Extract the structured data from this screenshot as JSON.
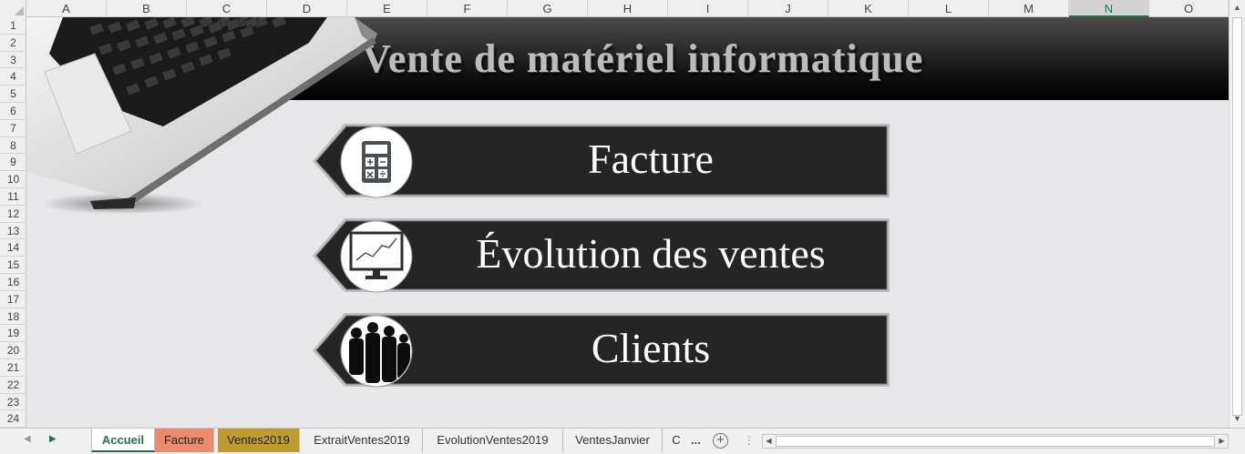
{
  "grid": {
    "columns": [
      "A",
      "B",
      "C",
      "D",
      "E",
      "F",
      "G",
      "H",
      "I",
      "J",
      "K",
      "L",
      "M",
      "N",
      "O"
    ],
    "selected_column": "N",
    "rows": [
      "1",
      "2",
      "3",
      "4",
      "5",
      "6",
      "7",
      "8",
      "9",
      "10",
      "11",
      "12",
      "13",
      "14",
      "15",
      "16",
      "17",
      "18",
      "19",
      "20",
      "21",
      "22",
      "23",
      "24"
    ]
  },
  "banner": {
    "title": "Vente de matériel informatique"
  },
  "buttons": [
    {
      "label": "Facture",
      "icon": "calculator-icon"
    },
    {
      "label": "Évolution des ventes",
      "icon": "chart-monitor-icon"
    },
    {
      "label": "Clients",
      "icon": "people-silhouette-icon"
    }
  ],
  "tabs": {
    "items": [
      {
        "label": "Accueil",
        "style": "active"
      },
      {
        "label": "Facture",
        "style": "orange",
        "color": "#ec8b6b"
      },
      {
        "label": "Ventes2019",
        "style": "gold",
        "color": "#bf9b2e"
      },
      {
        "label": "ExtraitVentes2019",
        "style": "plain"
      },
      {
        "label": "EvolutionVentes2019",
        "style": "plain"
      },
      {
        "label": "VentesJanvier",
        "style": "plain"
      },
      {
        "label": "C",
        "style": "plain"
      }
    ],
    "more": "...",
    "add": "+"
  },
  "colors": {
    "accent": "#217346",
    "banner": "#000000",
    "button": "#252525"
  }
}
